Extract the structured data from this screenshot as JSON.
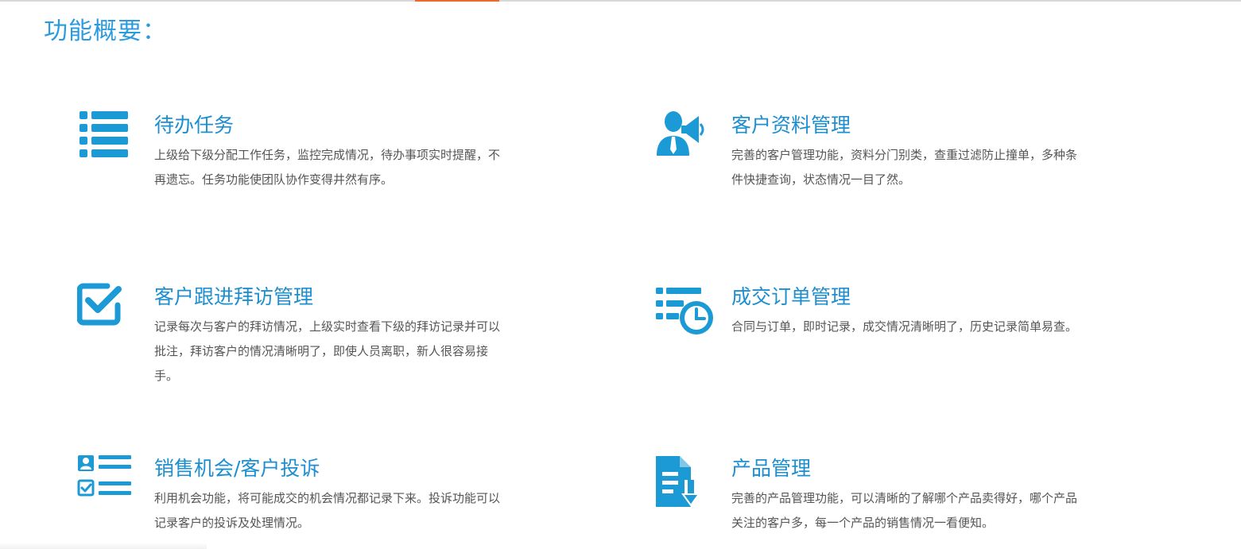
{
  "section": {
    "title": "功能概要："
  },
  "colors": {
    "accent": "#1d8fd1",
    "icon": "#1b9ad6",
    "title": "#2b9be0",
    "text": "#555555",
    "tab_accent": "#ee6a2c"
  },
  "features": [
    {
      "icon": "list-icon",
      "title": "待办任务",
      "description": "上级给下级分配工作任务，监控完成情况，待办事项实时提醒，不再遗忘。任务功能使团队协作变得井然有序。"
    },
    {
      "icon": "customer-megaphone-icon",
      "title": "客户资料管理",
      "description": "完善的客户管理功能，资料分门别类，查重过滤防止撞单，多种条件快捷查询，状态情况一目了然。"
    },
    {
      "icon": "checkbox-icon",
      "title": "客户跟进拜访管理",
      "description": "记录每次与客户的拜访情况，上级实时查看下级的拜访记录并可以批注，拜访客户的情况清晰明了，即使人员离职，新人很容易接手。"
    },
    {
      "icon": "list-clock-icon",
      "title": "成交订单管理",
      "description": "合同与订单，即时记录，成交情况清晰明了，历史记录简单易查。"
    },
    {
      "icon": "contact-checklist-icon",
      "title": "销售机会/客户投诉",
      "description": "利用机会功能，将可能成交的机会情况都记录下来。投诉功能可以记录客户的投诉及处理情况。"
    },
    {
      "icon": "document-download-icon",
      "title": "产品管理",
      "description": "完善的产品管理功能，可以清晰的了解哪个产品卖得好，哪个产品关注的客户多，每一个产品的销售情况一看便知。"
    }
  ]
}
